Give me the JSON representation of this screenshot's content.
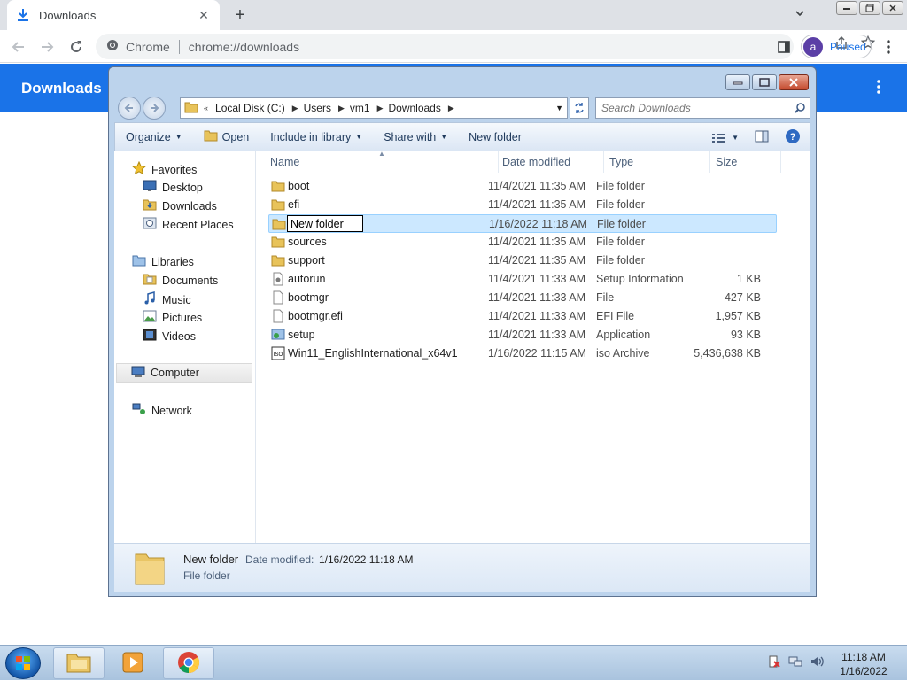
{
  "browser": {
    "tab_title": "Downloads",
    "omnibox_chip": "Chrome",
    "url": "chrome://downloads",
    "profile_initial": "a",
    "profile_status": "Paused"
  },
  "page": {
    "header_title": "Downloads",
    "accent": "#1a73e8"
  },
  "explorer": {
    "breadcrumb": [
      "Local Disk (C:)",
      "Users",
      "vm1",
      "Downloads"
    ],
    "search_placeholder": "Search Downloads",
    "commands": {
      "organize": "Organize",
      "open": "Open",
      "include_in_library": "Include in library",
      "share_with": "Share with",
      "new_folder": "New folder"
    },
    "nav": {
      "favorites": "Favorites",
      "desktop": "Desktop",
      "downloads": "Downloads",
      "recent_places": "Recent Places",
      "libraries": "Libraries",
      "documents": "Documents",
      "music": "Music",
      "pictures": "Pictures",
      "videos": "Videos",
      "computer": "Computer",
      "network": "Network"
    },
    "columns": {
      "name": "Name",
      "date_modified": "Date modified",
      "type": "Type",
      "size": "Size"
    },
    "files": [
      {
        "name": "boot",
        "date": "11/4/2021 11:35 AM",
        "type": "File folder",
        "size": "",
        "icon": "folder-icon"
      },
      {
        "name": "efi",
        "date": "11/4/2021 11:35 AM",
        "type": "File folder",
        "size": "",
        "icon": "folder-icon"
      },
      {
        "name": "New folder",
        "date": "1/16/2022 11:18 AM",
        "type": "File folder",
        "size": "",
        "icon": "folder-icon"
      },
      {
        "name": "sources",
        "date": "11/4/2021 11:35 AM",
        "type": "File folder",
        "size": "",
        "icon": "folder-icon"
      },
      {
        "name": "support",
        "date": "11/4/2021 11:35 AM",
        "type": "File folder",
        "size": "",
        "icon": "folder-icon"
      },
      {
        "name": "autorun",
        "date": "11/4/2021 11:33 AM",
        "type": "Setup Information",
        "size": "1 KB",
        "icon": "settings-file-icon"
      },
      {
        "name": "bootmgr",
        "date": "11/4/2021 11:33 AM",
        "type": "File",
        "size": "427 KB",
        "icon": "file-icon"
      },
      {
        "name": "bootmgr.efi",
        "date": "11/4/2021 11:33 AM",
        "type": "EFI File",
        "size": "1,957 KB",
        "icon": "file-icon"
      },
      {
        "name": "setup",
        "date": "11/4/2021 11:33 AM",
        "type": "Application",
        "size": "93 KB",
        "icon": "setup-app-icon"
      },
      {
        "name": "Win11_EnglishInternational_x64v1",
        "date": "1/16/2022 11:15 AM",
        "type": "iso Archive",
        "size": "5,436,638 KB",
        "icon": "iso-icon"
      }
    ],
    "rename_value": "New folder",
    "details": {
      "name": "New folder",
      "date_label": "Date modified:",
      "date_value": "1/16/2022 11:18 AM",
      "type": "File folder"
    }
  },
  "taskbar": {
    "time": "11:18 AM",
    "date": "1/16/2022"
  }
}
